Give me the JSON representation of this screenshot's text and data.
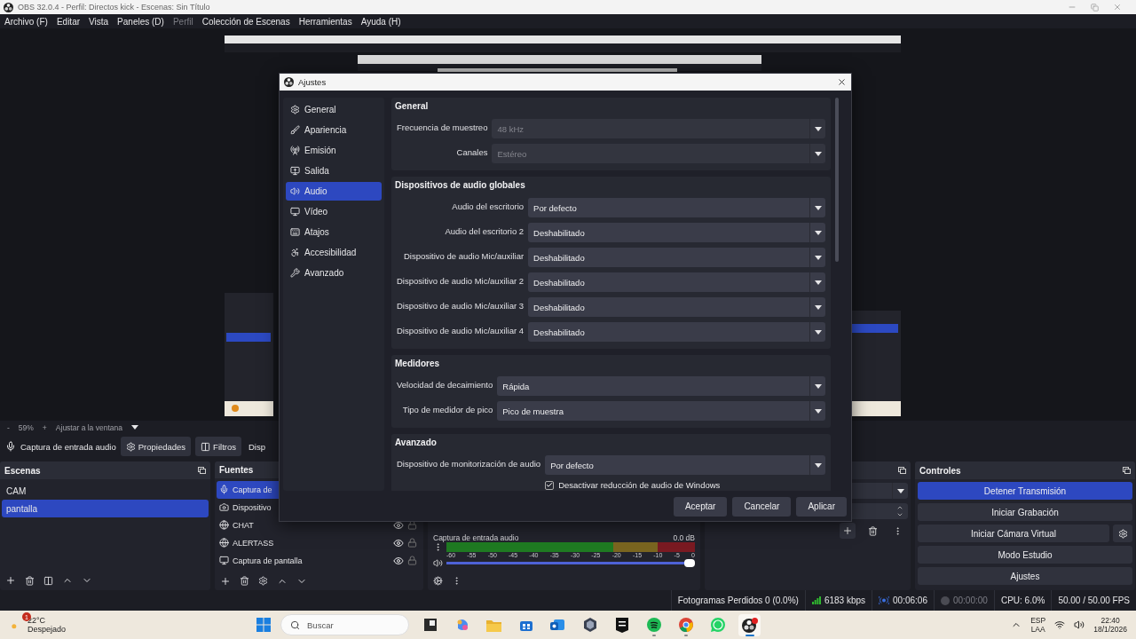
{
  "window": {
    "title": "OBS 32.0.4 - Perfil: Directos kick - Escenas: Sin Título"
  },
  "menu": [
    {
      "label": "Archivo (F)",
      "disabled": false
    },
    {
      "label": "Editar",
      "disabled": false
    },
    {
      "label": "Vista",
      "disabled": false
    },
    {
      "label": "Paneles (D)",
      "disabled": false
    },
    {
      "label": "Perfil",
      "disabled": true
    },
    {
      "label": "Colección de Escenas",
      "disabled": false
    },
    {
      "label": "Herramientas",
      "disabled": false
    },
    {
      "label": "Ayuda (H)",
      "disabled": false
    }
  ],
  "preview": {
    "kind": "picture",
    "zoom_out": "-",
    "zoom": "59%",
    "zoom_in": "+",
    "fit": "Ajustar a la ventana"
  },
  "source_toolbar": {
    "source": "Captura de entrada audio",
    "buttons": [
      {
        "label": "Propiedades",
        "kind": "properties"
      },
      {
        "label": "Filtros",
        "kind": "filters"
      },
      {
        "label": "Disp",
        "kind": "plain"
      }
    ]
  },
  "scenes": {
    "title": "Escenas",
    "items": [
      {
        "label": "CAM",
        "selected": false
      },
      {
        "label": "pantalla",
        "selected": true
      }
    ]
  },
  "sources": {
    "title": "Fuentes",
    "items": [
      {
        "label": "Captura de",
        "kind": "mic",
        "selected": true
      },
      {
        "label": "Dispositivo",
        "kind": "camera",
        "selected": false
      },
      {
        "label": "CHAT",
        "kind": "browser",
        "selected": false,
        "visible": true,
        "locked": false
      },
      {
        "label": "ALERTASS",
        "kind": "browser",
        "selected": false,
        "visible": true,
        "locked": false
      },
      {
        "label": "Captura de pantalla",
        "kind": "display",
        "selected": false,
        "visible": true,
        "locked": false
      }
    ]
  },
  "mixer": {
    "channels": [
      {
        "name": "Captura de entrada audio",
        "reading": "0.0 dB",
        "level": 1,
        "muted": false
      }
    ],
    "ticks": [
      "-60",
      "-55",
      "-50",
      "-45",
      "-40",
      "-35",
      "-30",
      "-25",
      "-20",
      "-15",
      "-10",
      "-5",
      "0"
    ]
  },
  "controls": {
    "title": "Controles",
    "buttons": [
      {
        "label": "Detener Transmisión",
        "active": true,
        "has_settings": false
      },
      {
        "label": "Iniciar Grabación",
        "active": false,
        "has_settings": false
      },
      {
        "label": "Iniciar Cámara Virtual",
        "active": false,
        "has_settings": true
      },
      {
        "label": "Modo Estudio",
        "active": false,
        "has_settings": false
      },
      {
        "label": "Ajustes",
        "active": false,
        "has_settings": false
      }
    ]
  },
  "status_bar": [
    {
      "kind": "text",
      "text": "Fotogramas Perdidos 0 (0.0%)"
    },
    {
      "kind": "bitrate",
      "text": "6183 kbps"
    },
    {
      "kind": "stream",
      "text": "00:06:06",
      "active": true
    },
    {
      "kind": "record",
      "text": "00:00:00",
      "active": false
    },
    {
      "kind": "text",
      "text": "CPU: 6.0%"
    },
    {
      "kind": "text",
      "text": "50.00 / 50.00 FPS"
    }
  ],
  "settings": {
    "title": "Ajustes",
    "nav": [
      {
        "label": "General",
        "selected": false
      },
      {
        "label": "Apariencia",
        "selected": false
      },
      {
        "label": "Emisión",
        "selected": false
      },
      {
        "label": "Salida",
        "selected": false
      },
      {
        "label": "Audio",
        "selected": true
      },
      {
        "label": "Vídeo",
        "selected": false
      },
      {
        "label": "Atajos",
        "selected": false
      },
      {
        "label": "Accesibilidad",
        "selected": false
      },
      {
        "label": "Avanzado",
        "selected": false
      }
    ],
    "sections": [
      {
        "title": "General",
        "rows": [
          {
            "label": "Frecuencia de muestreo",
            "value": "48 kHz",
            "disabled": true
          },
          {
            "label": "Canales",
            "value": "Estéreo",
            "disabled": true
          }
        ]
      },
      {
        "title": "Dispositivos de audio globales",
        "rows": [
          {
            "label": "Audio del escritorio",
            "value": "Por defecto",
            "disabled": false
          },
          {
            "label": "Audio del escritorio 2",
            "value": "Deshabilitado",
            "disabled": false
          },
          {
            "label": "Dispositivo de audio Mic/auxiliar",
            "value": "Deshabilitado",
            "disabled": false
          },
          {
            "label": "Dispositivo de audio Mic/auxiliar 2",
            "value": "Deshabilitado",
            "disabled": false
          },
          {
            "label": "Dispositivo de audio Mic/auxiliar 3",
            "value": "Deshabilitado",
            "disabled": false
          },
          {
            "label": "Dispositivo de audio Mic/auxiliar 4",
            "value": "Deshabilitado",
            "disabled": false
          }
        ]
      },
      {
        "title": "Medidores",
        "rows": [
          {
            "label": "Velocidad de decaimiento",
            "value": "Rápida",
            "disabled": false
          },
          {
            "label": "Tipo de medidor de pico",
            "value": "Pico de muestra",
            "disabled": false
          }
        ]
      },
      {
        "title": "Avanzado",
        "rows": [
          {
            "label": "Dispositivo de monitorización de audio",
            "value": "Por defecto",
            "disabled": false
          }
        ],
        "checkbox": {
          "label": "Desactivar reducción de audio de Windows",
          "checked": true
        }
      }
    ],
    "buttons": [
      "Aceptar",
      "Cancelar",
      "Aplicar"
    ]
  },
  "taskbar": {
    "weather": {
      "badge": "1",
      "temp": "22°C",
      "condition": "Despejado"
    },
    "search": {
      "placeholder": "Buscar"
    },
    "apps": [
      {
        "kind": "tiles",
        "running": false,
        "active": false
      },
      {
        "kind": "swirl",
        "running": false,
        "active": false
      },
      {
        "kind": "folder",
        "running": false,
        "active": false
      },
      {
        "kind": "store",
        "running": false,
        "active": false
      },
      {
        "kind": "mail",
        "running": false,
        "active": false
      },
      {
        "kind": "cube",
        "running": false,
        "active": false
      },
      {
        "kind": "launcher",
        "running": false,
        "active": false
      },
      {
        "kind": "music",
        "running": true,
        "active": false
      },
      {
        "kind": "browser",
        "running": true,
        "active": false
      },
      {
        "kind": "chat",
        "running": false,
        "active": false
      },
      {
        "kind": "recorder",
        "running": true,
        "active": true
      }
    ],
    "tray": {
      "language": "ESP",
      "layout": "LAA",
      "time": "22:40",
      "date": "18/1/2026"
    }
  }
}
